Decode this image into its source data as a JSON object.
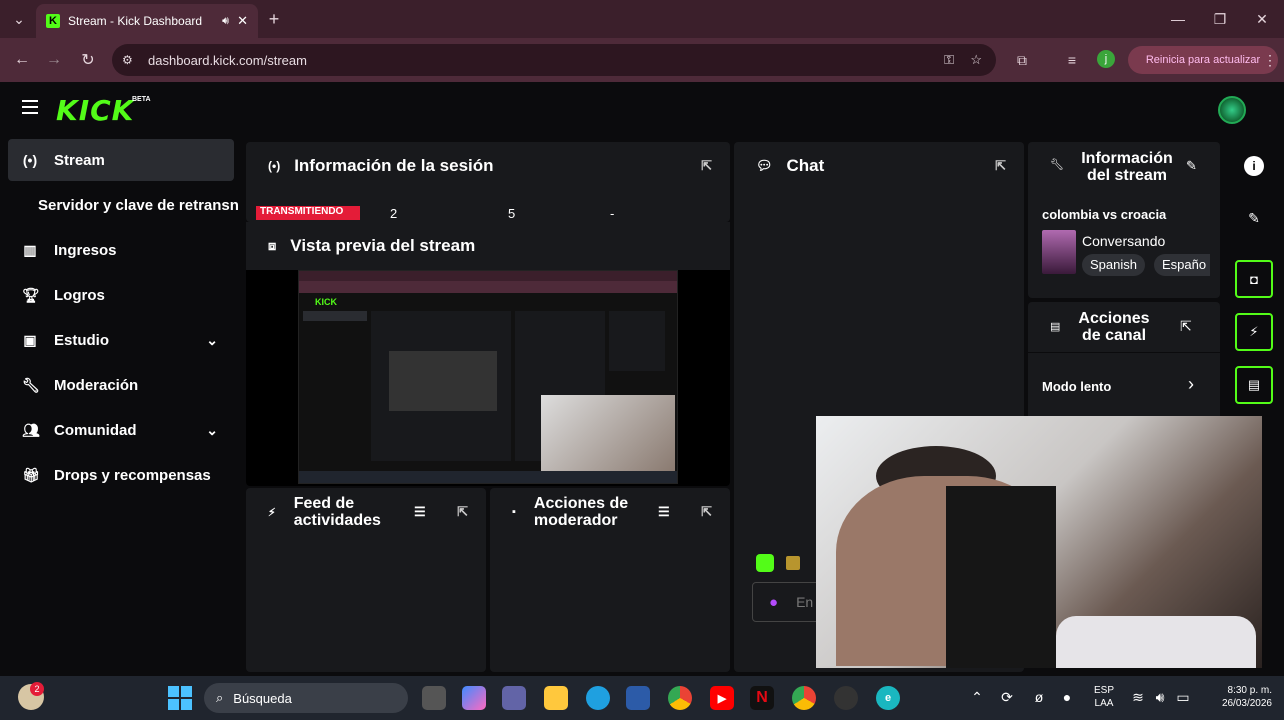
{
  "browser": {
    "tab_title": "Stream - Kick Dashboard",
    "url": "dashboard.kick.com/stream",
    "update_label": "Reinicia para actualizar",
    "profile_initial": "j"
  },
  "app": {
    "logo": "KICK",
    "beta": "BETA"
  },
  "sidebar": {
    "items": [
      {
        "label": "Stream",
        "icon": "broadcast-icon"
      },
      {
        "label": "Servidor y clave de retransn"
      },
      {
        "label": "Ingresos",
        "icon": "chart-icon"
      },
      {
        "label": "Logros",
        "icon": "trophy-icon"
      },
      {
        "label": "Estudio",
        "icon": "studio-icon"
      },
      {
        "label": "Moderación",
        "icon": "wrench-icon"
      },
      {
        "label": "Comunidad",
        "icon": "users-icon"
      },
      {
        "label": "Drops y recompensas",
        "icon": "gift-icon"
      }
    ]
  },
  "session": {
    "title": "Información de la sesión",
    "badge": "TRANSMITIENDO",
    "stat1": "2",
    "stat2": "5",
    "stat3": "-"
  },
  "preview": {
    "title": "Vista previa del stream"
  },
  "feed": {
    "title": "Feed de actividades"
  },
  "modactions": {
    "title": "Acciones de moderador"
  },
  "chat": {
    "title": "Chat",
    "input_placeholder": "En"
  },
  "streaminfo": {
    "title": "Información del stream",
    "stream_title": "colombia vs croacia",
    "category": "Conversando",
    "tags": [
      "Spanish",
      "Españo"
    ]
  },
  "channel": {
    "title": "Acciones de canal",
    "slow_mode": "Modo lento"
  },
  "taskbar": {
    "search": "Búsqueda",
    "lang1": "ESP",
    "lang2": "LAA",
    "time": "8:30 p. m.",
    "date": "26/03/2026",
    "notif": "2"
  },
  "colors": {
    "accent": "#53fc18",
    "live": "#e41c38"
  }
}
